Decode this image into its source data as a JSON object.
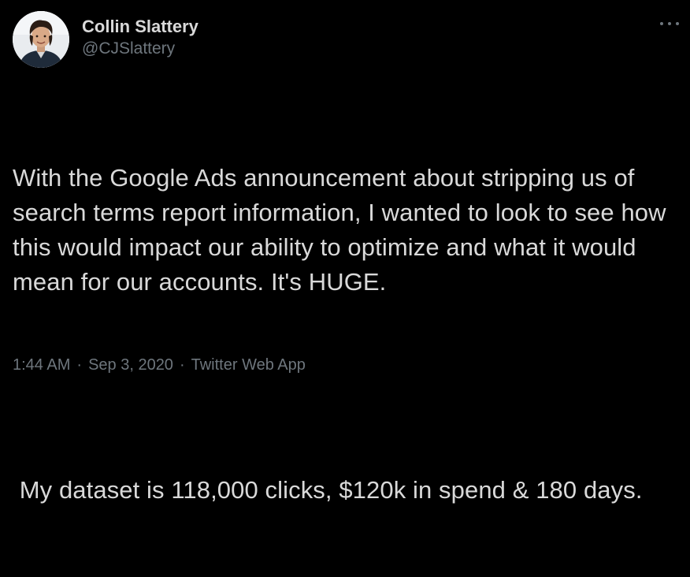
{
  "author": {
    "display_name": "Collin Slattery",
    "handle": "@CJSlattery"
  },
  "tweet": {
    "paragraph_1": "With the Google Ads announcement about stripping us of search terms report information, I wanted to look to see how this would impact our ability to optimize and what it would mean for our accounts. It's HUGE.",
    "paragraph_2": " My dataset is 118,000 clicks, $120k in spend & 180 days."
  },
  "footer": {
    "time": "1:44 AM",
    "separator": "·",
    "date": "Sep 3, 2020",
    "source": "Twitter Web App"
  },
  "icons": {
    "more": "more-horizontal-icon",
    "avatar": "profile-photo"
  },
  "colors": {
    "background": "#000000",
    "text_primary": "#d9d9d9",
    "text_secondary": "#6e767d"
  }
}
